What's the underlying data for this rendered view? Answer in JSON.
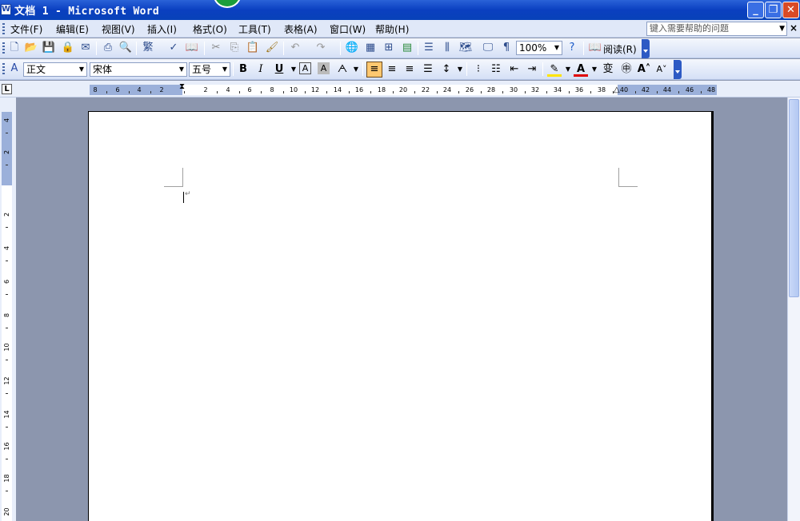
{
  "window": {
    "title": "文档 1 - Microsoft Word",
    "app_icon": "W",
    "minimize": "_",
    "maximize": "❐",
    "close": "✕"
  },
  "menu": {
    "items": [
      "文件(F)",
      "编辑(E)",
      "视图(V)",
      "插入(I)",
      "格式(O)",
      "工具(T)",
      "表格(A)",
      "窗口(W)",
      "帮助(H)"
    ],
    "help_placeholder": "键入需要帮助的问题",
    "close": "×"
  },
  "toolbar_standard": {
    "zoom": "100%",
    "read_label": "阅读(R)"
  },
  "toolbar_format": {
    "style": "正文",
    "font": "宋体",
    "size": "五号",
    "bold": "B",
    "italic": "I",
    "underline": "U"
  },
  "ruler": {
    "corner": "L",
    "h_labels": [
      "8",
      "6",
      "4",
      "2",
      "2",
      "4",
      "6",
      "8",
      "10",
      "12",
      "14",
      "16",
      "18",
      "20",
      "22",
      "24",
      "26",
      "28",
      "30",
      "32",
      "34",
      "36",
      "38",
      "40",
      "42",
      "44",
      "46",
      "48"
    ],
    "v_labels": [
      "4",
      "2",
      "2",
      "4",
      "6",
      "8",
      "10",
      "12",
      "14",
      "16",
      "18",
      "20"
    ]
  },
  "document": {
    "paragraph_mark": "↵"
  },
  "colors": {
    "title_bar": "#0a3fc0",
    "toolbar": "#d5e0f6",
    "workspace": "#8c96ae",
    "ruler_shade": "#9bb0da",
    "highlight": "#ffe400",
    "font_color": "#e00000"
  }
}
